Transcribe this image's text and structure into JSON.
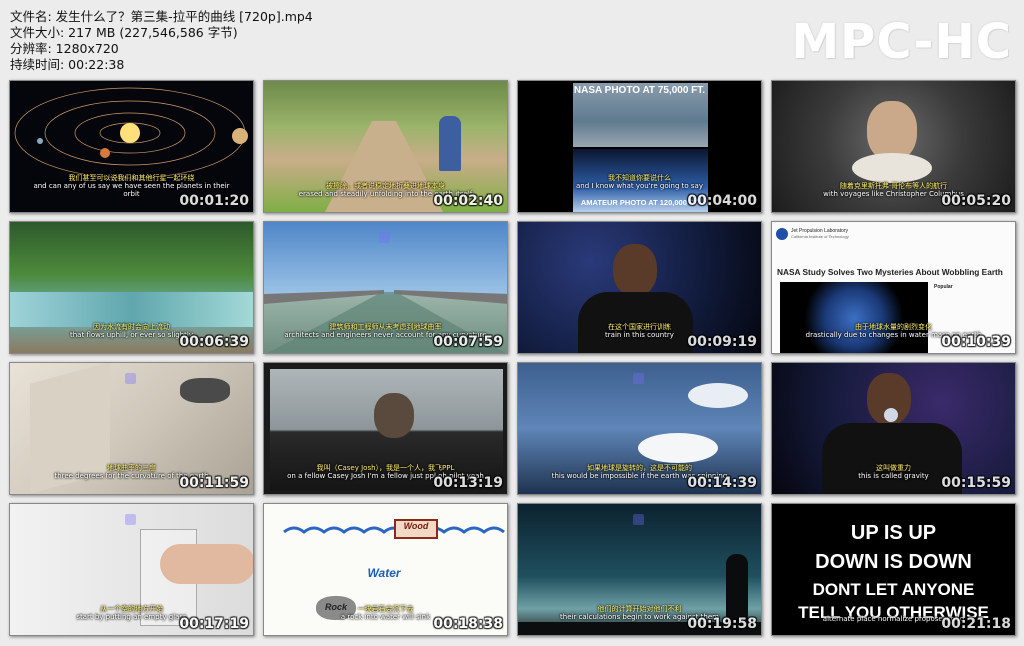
{
  "file_info": {
    "filename": "文件名: 发生什么了？第三集-拉平的曲线 [720p].mp4",
    "filesize": "文件大小: 217 MB (227,546,586 字节)",
    "resolution": "分辨率: 1280x720",
    "duration": "持续时间: 00:22:38"
  },
  "brand": "MPC-HC",
  "thumbnails": [
    {
      "time": "00:01:20",
      "cn": "我们甚至可以说我们和其他行星一起环绕",
      "en": "and can any of us say we have seen the planets in their orbit"
    },
    {
      "time": "00:02:40",
      "cn": "被擦除，或者说稳定地折叠进地球本身",
      "en": "erased and steadily unfolding into the earth itself"
    },
    {
      "time": "00:04:00",
      "cn": "我不知道你要说什么",
      "en": "and I know what you're going to say",
      "top_label": "NASA PHOTO AT 75,000 FT.",
      "bottom_label": "AMATEUR PHOTO AT 120,000 FT"
    },
    {
      "time": "00:05:20",
      "cn": "随着克里斯托弗·哥伦布等人的航行",
      "en": "with voyages like Christopher Columbus"
    },
    {
      "time": "00:06:39",
      "cn": "因为水流有时会向上流动",
      "en": "that flows uphill, or ever so slightly"
    },
    {
      "time": "00:07:59",
      "cn": "建筑师和工程师从未考虑到地球曲率",
      "en": "architects and engineers never account for any curvature"
    },
    {
      "time": "00:09:19",
      "cn": "在这个国家进行训练",
      "en": "train in this country"
    },
    {
      "time": "00:10:39",
      "cn": "由于地球水量的剧烈变化",
      "en": "drastically due to changes in water mass on earth",
      "web_header": "Jet Propulsion Laboratory",
      "web_sub": "California Institute of Technology",
      "web_title": "NASA Study Solves Two Mysteries About Wobbling Earth",
      "web_popular": "Popular"
    },
    {
      "time": "00:11:59",
      "cn": "地球曲率的三度",
      "en": "three degrees for the curvature of the earth"
    },
    {
      "time": "00:13:19",
      "cn": "我叫（Casey Josh），我是一个人，我飞PPL",
      "en": "on a fellow Casey Josh I'm a fellow just ppl oh pilot yeah"
    },
    {
      "time": "00:14:39",
      "cn": "如果地球是旋转的，这是不可能的",
      "en": "this would be impossible if the earth was spinning"
    },
    {
      "time": "00:15:59",
      "cn": "这叫做重力",
      "en": "this is called gravity"
    },
    {
      "time": "00:17:19",
      "cn": "从一个空的地方开始",
      "en": "start by putting an empty glass"
    },
    {
      "time": "00:18:38",
      "cn": "一块岩石会沉下去",
      "en": "a rock into water will sink",
      "label_wood": "Wood",
      "label_water": "Water",
      "label_rock": "Rock"
    },
    {
      "time": "00:19:58",
      "cn": "他们的计算开始对他们不利",
      "en": "their calculations begin to work against them"
    },
    {
      "time": "00:21:18",
      "cn": "",
      "en": "alternate place normalize propose world",
      "lines": [
        "UP IS UP",
        "DOWN IS DOWN",
        "DONT LET ANYONE",
        "TELL YOU OTHERWISE"
      ]
    }
  ],
  "colors": {
    "background": "#ececec",
    "subtitle_cn": "#ffef6a",
    "subtitle_en": "#ffffff"
  }
}
